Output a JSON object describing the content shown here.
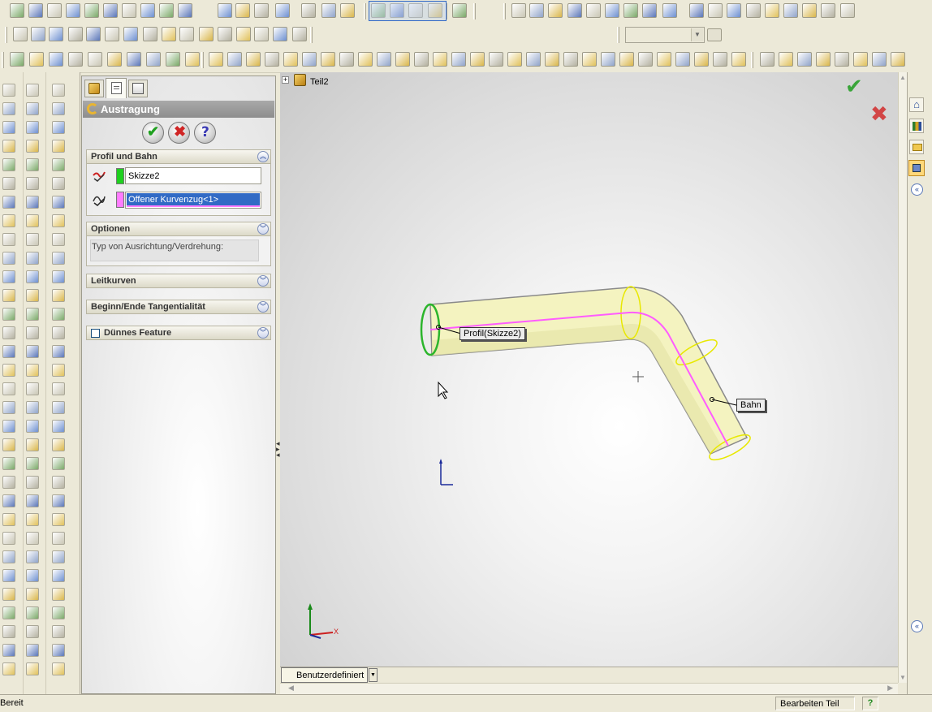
{
  "feature_panel": {
    "title": "Austragung",
    "profile_path": {
      "header": "Profil und Bahn",
      "profile_value": "Skizze2",
      "path_value": "Offener Kurvenzug<1>"
    },
    "options": {
      "header": "Optionen",
      "orientation_label": "Typ von Ausrichtung/Verdrehung:"
    },
    "guide_curves": {
      "header": "Leitkurven"
    },
    "tangency": {
      "header": "Beginn/Ende Tangentialität"
    },
    "thin_feature": {
      "header": "Dünnes Feature"
    }
  },
  "tree": {
    "part_name": "Teil2"
  },
  "viewport": {
    "callout_profile": "Profil(Skizze2)",
    "callout_path": "Bahn",
    "view_mode": "Benutzerdefiniert",
    "axis_x": "X",
    "colors": {
      "profile": "#2cb52c",
      "path": "#ff5cff",
      "body": "#f4f3c0"
    }
  },
  "status": {
    "left": "Bereit",
    "mode": "Bearbeiten Teil"
  }
}
